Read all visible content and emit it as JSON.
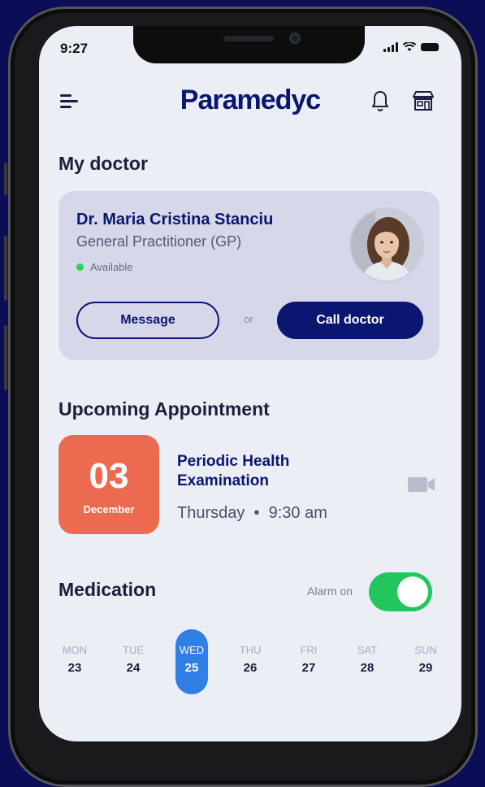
{
  "status_bar": {
    "time": "9:27"
  },
  "header": {
    "brand": "Paramedyc"
  },
  "my_doctor": {
    "section_title": "My doctor",
    "name": "Dr. Maria Cristina Stanciu",
    "role": "General Practitioner (GP)",
    "status": "Available",
    "message_label": "Message",
    "or_label": "or",
    "call_label": "Call doctor"
  },
  "appointment": {
    "section_title": "Upcoming Appointment",
    "day": "03",
    "month": "December",
    "title": "Periodic Health Examination",
    "weekday": "Thursday",
    "time": "9:30 am"
  },
  "medication": {
    "section_title": "Medication",
    "alarm_label": "Alarm on",
    "alarm_on": true,
    "days": [
      {
        "name": "MON",
        "num": "23"
      },
      {
        "name": "TUE",
        "num": "24"
      },
      {
        "name": "WED",
        "num": "25",
        "selected": true
      },
      {
        "name": "THU",
        "num": "26"
      },
      {
        "name": "FRI",
        "num": "27"
      },
      {
        "name": "SAT",
        "num": "28"
      },
      {
        "name": "SUN",
        "num": "29"
      }
    ]
  },
  "colors": {
    "brand": "#0b1670",
    "accent_orange": "#ec6a50",
    "selected_day": "#2f7fe6",
    "toggle_on": "#22c55e",
    "available": "#2bd15c"
  },
  "icons": [
    "menu-icon",
    "bell-icon",
    "store-icon",
    "video-icon"
  ]
}
